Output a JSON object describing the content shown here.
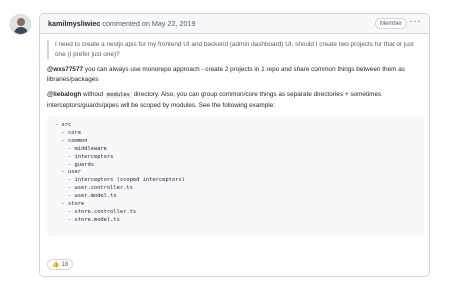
{
  "comment": {
    "author": "kamilmysliwiec",
    "meta": "commented on May 22, 2019",
    "badge": "Member",
    "menu_icon": "kebab-horizontal-icon",
    "quote": "I need to create a nestjs apis for my frontend UI and backend (admin dashboard) UI, should I create two projects for that or just one (I prefer just one)?",
    "p1_mention": "@wxs77577",
    "p1_text": " you can always use monorepo approach - create 2 projects in 1 repo and share common things between them as libraries/packages",
    "p2_mention": "@liebalogh",
    "p2_text_a": " without ",
    "p2_code": "modules",
    "p2_text_b": " directory. Also, you can group common/core things as separate directories + sometimes interceptors/guards/pipes will be scoped by modules. See the following example:",
    "code_block": "- src\n  - core\n  - common\n    - middleware\n    - interceptors\n    - guards\n  - user\n    - interceptors (scoped interceptors)\n    - user.controller.ts\n    - user.model.ts\n  - store\n    - store.controller.ts\n    - store.model.ts",
    "reaction": {
      "icon": "thumbs-up-icon",
      "emoji": "👍",
      "count": "18"
    }
  }
}
